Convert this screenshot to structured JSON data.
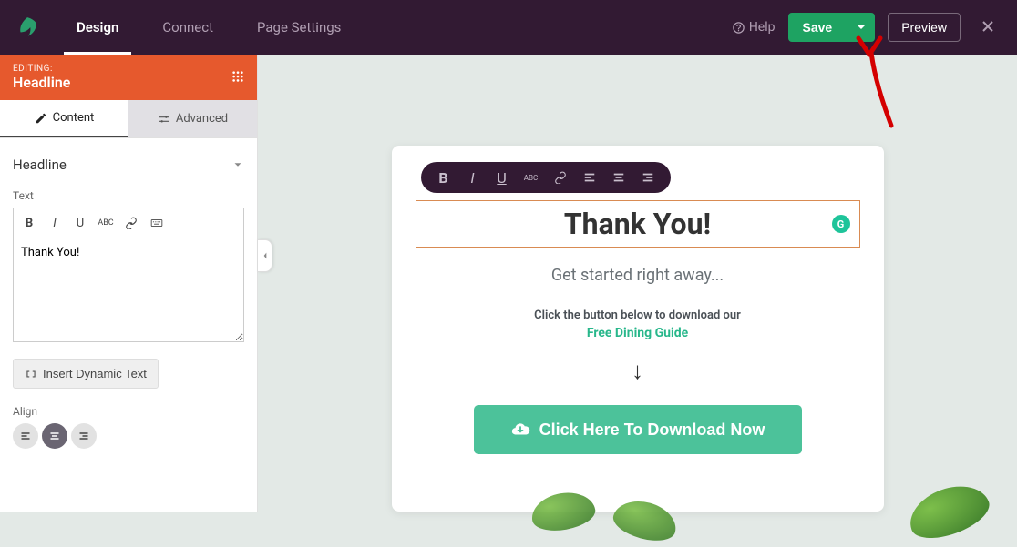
{
  "topbar": {
    "tabs": {
      "design": "Design",
      "connect": "Connect",
      "page_settings": "Page Settings"
    },
    "help_label": "Help",
    "save_label": "Save",
    "preview_label": "Preview"
  },
  "sidebar": {
    "editing_label": "EDITING:",
    "editing_name": "Headline",
    "subtabs": {
      "content": "Content",
      "advanced": "Advanced"
    },
    "section_title": "Headline",
    "text_label": "Text",
    "text_value": "Thank You!",
    "insert_dynamic_label": "Insert Dynamic Text",
    "align_label": "Align"
  },
  "canvas": {
    "headline": "Thank You!",
    "subhead": "Get started right away...",
    "instr": "Click the button below to download our",
    "guide_link": "Free Dining Guide",
    "arrow": "↓",
    "cta_label": "Click Here To Download Now",
    "grammarly_badge": "G"
  }
}
